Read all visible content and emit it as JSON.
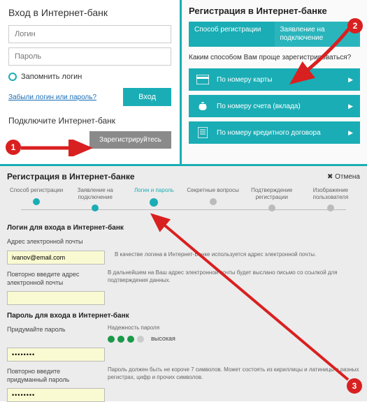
{
  "login": {
    "title": "Вход в Интернет-банк",
    "login_ph": "Логин",
    "pass_ph": "Пароль",
    "remember": "Запомнить логин",
    "forgot": "Забыли логин или пароль?",
    "enter": "Вход",
    "connect": "Подключите Интернет-банк",
    "register": "Зарегистрируйтесь"
  },
  "reg": {
    "title": "Регистрация в Интернет-банке",
    "tab1": "Способ регистрации",
    "tab2": "Заявление на подключение",
    "q": "Каким способом Вам проще зарегистрироваться?",
    "opt1": "По номеру карты",
    "opt2": "По номеру счета (вклада)",
    "opt3": "По номеру кредитного договора"
  },
  "bottom": {
    "title": "Регистрация в Интернет-банке",
    "cancel": "✖ Отмена",
    "steps": [
      "Способ регистрации",
      "Заявление на подключение",
      "Логин и пароль",
      "Секретные вопросы",
      "Подтверждение регистрации",
      "Изображение пользователя"
    ],
    "sect1": "Логин для входа в Интернет-банк",
    "email_label": "Адрес электронной почты",
    "email_val": "ivanov@email.com",
    "email2_label": "Повторно введите адрес электронной почты",
    "hint1": "В качестве логина в Интернет-Банке используется адрес электронной почты.",
    "hint2": "В дальнейшем на Ваш адрес электронной почты будет выслано письмо со ссылкой для подтверждения данных.",
    "sect2": "Пароль для входа в Интернет-банк",
    "pw_label": "Придумайте пароль",
    "pw_val": "••••••••",
    "pw2_label": "Повторно введите придуманный пароль",
    "strength_title": "Надежность пароля",
    "strength_val": "высокая",
    "pw_hint": "Пароль должен быть не короче 7 символов. Может состоять из кириллицы и латиницы в разных регистрах, цифр и прочих символов."
  },
  "badges": {
    "n1": "1",
    "n2": "2",
    "n3": "3"
  }
}
